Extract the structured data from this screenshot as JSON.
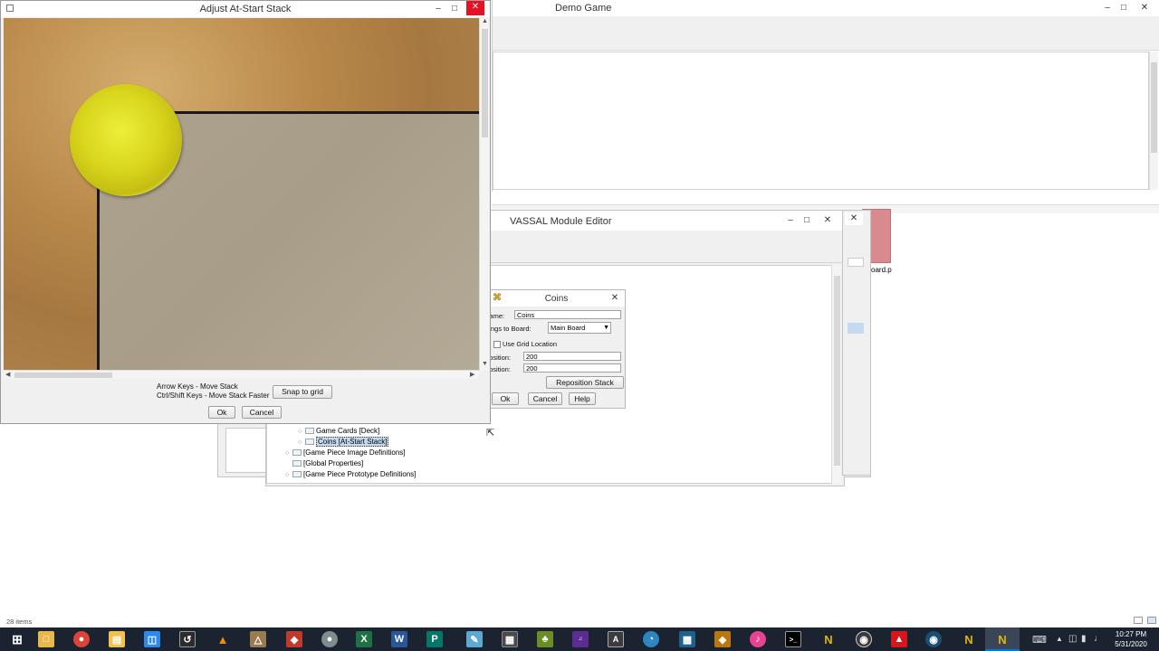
{
  "adjust_window": {
    "title": "Adjust At-Start Stack",
    "hint_line1": "Arrow Keys - Move Stack",
    "hint_line2": "Ctrl/Shift Keys - Move Stack Faster",
    "snap_label": "Snap to grid",
    "ok_label": "Ok",
    "cancel_label": "Cancel"
  },
  "demo_window": {
    "title": "Demo Game"
  },
  "editor_window": {
    "title": "VASSAL Module Editor",
    "tree": [
      "Game Cards [Deck]",
      "Coins [At-Start Stack]",
      "[Game Piece Image Definitions]",
      "[Global Properties]",
      "[Game Piece Prototype Definitions]"
    ]
  },
  "coins_dialog": {
    "title": "Coins",
    "name_label": "Name:",
    "name_value": "Coins",
    "board_label": "Belongs to Board:",
    "board_value": "Main Board",
    "grid_label": "Use Grid Location",
    "x_label": "X position:",
    "x_value": "200",
    "y_label": "Y position:",
    "y_value": "200",
    "reposition_label": "Reposition Stack",
    "ok_label": "Ok",
    "cancel_label": "Cancel",
    "help_label": "Help"
  },
  "background": {
    "partial_filename": "oard.p"
  },
  "explorer_status": "28 items",
  "taskbar": {
    "time": "10:27 PM",
    "date": "5/31/2020",
    "apps": [
      "start-icon",
      "file-explorer-icon",
      "chrome-icon",
      "folder-icon",
      "remote-icon",
      "terminal-icon",
      "vlc-icon",
      "app-icon",
      "app-icon",
      "app-icon",
      "excel-icon",
      "word-icon",
      "publisher-icon",
      "app-icon",
      "calculator-icon",
      "app-icon",
      "amazon-music-icon",
      "app-icon",
      "app-icon",
      "app-icon",
      "app-icon",
      "itunes-icon",
      "cmd-icon",
      "vassal-icon",
      "obs-icon",
      "acrobat-icon",
      "steam-icon",
      "vassal-icon",
      "vassal-icon"
    ]
  },
  "colors": {
    "accent": "#0078d7",
    "taskbar": "#1b2330",
    "selection": "#c5d9f1",
    "close": "#e81123"
  }
}
